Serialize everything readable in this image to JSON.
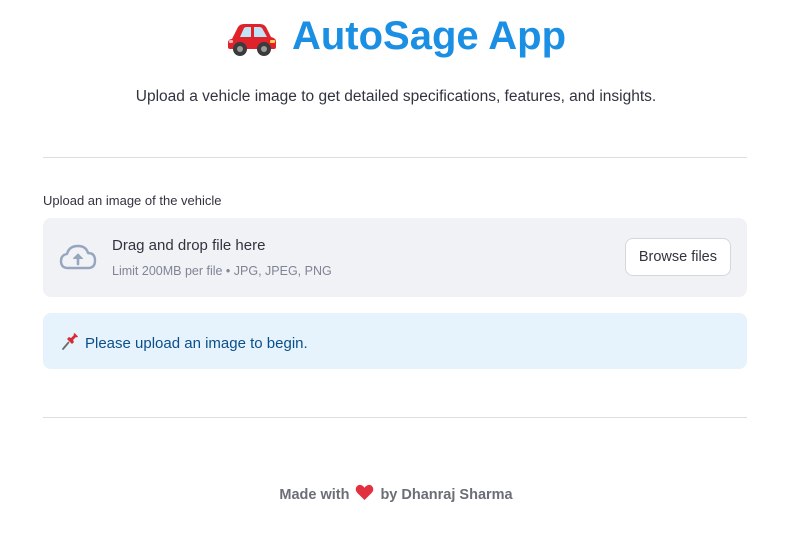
{
  "header": {
    "title": "AutoSage App",
    "title_emoji_icon": "red-car-icon",
    "subtitle": "Upload a vehicle image to get detailed specifications, features, and insights.",
    "title_color": "#1a8fe3"
  },
  "uploader": {
    "label": "Upload an image of the vehicle",
    "dropzone_main": "Drag and drop file here",
    "dropzone_sub": "Limit 200MB per file • JPG, JPEG, PNG",
    "browse_label": "Browse files",
    "icon": "cloud-upload-icon"
  },
  "info": {
    "icon": "pushpin-icon",
    "message": "Please upload an image to begin.",
    "background": "#e6f2fc"
  },
  "footer": {
    "prefix": "Made with",
    "icon": "heart-icon",
    "suffix": "by Dhanraj Sharma"
  }
}
